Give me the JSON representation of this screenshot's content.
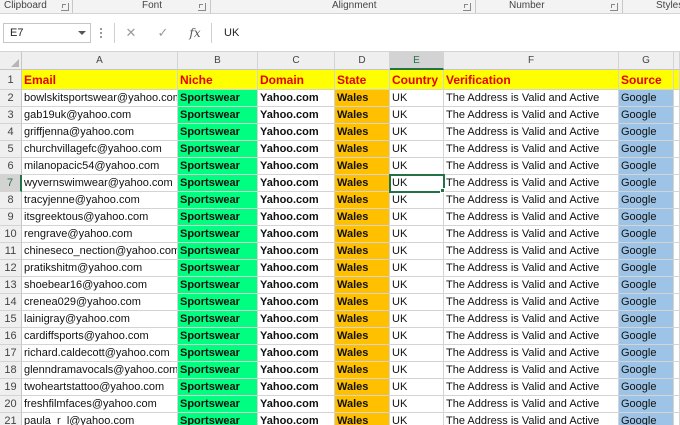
{
  "ribbon": {
    "groups": [
      "Clipboard",
      "Font",
      "Alignment",
      "Number",
      "Styles"
    ]
  },
  "formula_bar": {
    "name_box": "E7",
    "cancel_symbol": "✕",
    "enter_symbol": "✓",
    "fx_symbol": "fx",
    "content": "UK"
  },
  "columns": [
    "A",
    "B",
    "C",
    "D",
    "E",
    "F",
    "G"
  ],
  "selected_cell": {
    "column": "E",
    "row": 7
  },
  "sheet": {
    "header_row": {
      "row": 1,
      "cells": [
        "Email",
        "Niche",
        "Domain",
        "State",
        "Country",
        "Verification",
        "Source"
      ]
    },
    "rows": [
      {
        "row": 2,
        "email": "bowlskitsportswear@yahoo.com",
        "niche": "Sportswear",
        "domain": "Yahoo.com",
        "state": "Wales",
        "country": "UK",
        "verification": "The Address is Valid and  Active",
        "source": "Google"
      },
      {
        "row": 3,
        "email": "gab19uk@yahoo.com",
        "niche": "Sportswear",
        "domain": "Yahoo.com",
        "state": "Wales",
        "country": "UK",
        "verification": "The Address is Valid and  Active",
        "source": "Google"
      },
      {
        "row": 4,
        "email": "griffjenna@yahoo.com",
        "niche": "Sportswear",
        "domain": "Yahoo.com",
        "state": "Wales",
        "country": "UK",
        "verification": "The Address is Valid and  Active",
        "source": "Google"
      },
      {
        "row": 5,
        "email": "churchvillagefc@yahoo.com",
        "niche": "Sportswear",
        "domain": "Yahoo.com",
        "state": "Wales",
        "country": "UK",
        "verification": "The Address is Valid and  Active",
        "source": "Google"
      },
      {
        "row": 6,
        "email": "milanopacic54@yahoo.com",
        "niche": "Sportswear",
        "domain": "Yahoo.com",
        "state": "Wales",
        "country": "UK",
        "verification": "The Address is Valid and  Active",
        "source": "Google"
      },
      {
        "row": 7,
        "email": "wyvernswimwear@yahoo.com",
        "niche": "Sportswear",
        "domain": "Yahoo.com",
        "state": "Wales",
        "country": "UK",
        "verification": "The Address is Valid and  Active",
        "source": "Google"
      },
      {
        "row": 8,
        "email": "tracyjenne@yahoo.com",
        "niche": "Sportswear",
        "domain": "Yahoo.com",
        "state": "Wales",
        "country": "UK",
        "verification": "The Address is Valid and  Active",
        "source": "Google"
      },
      {
        "row": 9,
        "email": "itsgreektous@yahoo.com",
        "niche": "Sportswear",
        "domain": "Yahoo.com",
        "state": "Wales",
        "country": "UK",
        "verification": "The Address is Valid and  Active",
        "source": "Google"
      },
      {
        "row": 10,
        "email": "rengrave@yahoo.com",
        "niche": "Sportswear",
        "domain": "Yahoo.com",
        "state": "Wales",
        "country": "UK",
        "verification": "The Address is Valid and  Active",
        "source": "Google"
      },
      {
        "row": 11,
        "email": "chineseco_nection@yahoo.com",
        "niche": "Sportswear",
        "domain": "Yahoo.com",
        "state": "Wales",
        "country": "UK",
        "verification": "The Address is Valid and  Active",
        "source": "Google"
      },
      {
        "row": 12,
        "email": "pratikshitm@yahoo.com",
        "niche": "Sportswear",
        "domain": "Yahoo.com",
        "state": "Wales",
        "country": "UK",
        "verification": "The Address is Valid and  Active",
        "source": "Google"
      },
      {
        "row": 13,
        "email": "shoebear16@yahoo.com",
        "niche": "Sportswear",
        "domain": "Yahoo.com",
        "state": "Wales",
        "country": "UK",
        "verification": "The Address is Valid and  Active",
        "source": "Google"
      },
      {
        "row": 14,
        "email": "crenea029@yahoo.com",
        "niche": "Sportswear",
        "domain": "Yahoo.com",
        "state": "Wales",
        "country": "UK",
        "verification": "The Address is Valid and  Active",
        "source": "Google"
      },
      {
        "row": 15,
        "email": "lainigray@yahoo.com",
        "niche": "Sportswear",
        "domain": "Yahoo.com",
        "state": "Wales",
        "country": "UK",
        "verification": "The Address is Valid and  Active",
        "source": "Google"
      },
      {
        "row": 16,
        "email": "cardiffsports@yahoo.com",
        "niche": "Sportswear",
        "domain": "Yahoo.com",
        "state": "Wales",
        "country": "UK",
        "verification": "The Address is Valid and  Active",
        "source": "Google"
      },
      {
        "row": 17,
        "email": "richard.caldecott@yahoo.com",
        "niche": "Sportswear",
        "domain": "Yahoo.com",
        "state": "Wales",
        "country": "UK",
        "verification": "The Address is Valid and  Active",
        "source": "Google"
      },
      {
        "row": 18,
        "email": "glenndramavocals@yahoo.com",
        "niche": "Sportswear",
        "domain": "Yahoo.com",
        "state": "Wales",
        "country": "UK",
        "verification": "The Address is Valid and  Active",
        "source": "Google"
      },
      {
        "row": 19,
        "email": "twoheartstattoo@yahoo.com",
        "niche": "Sportswear",
        "domain": "Yahoo.com",
        "state": "Wales",
        "country": "UK",
        "verification": "The Address is Valid and  Active",
        "source": "Google"
      },
      {
        "row": 20,
        "email": "freshfilmfaces@yahoo.com",
        "niche": "Sportswear",
        "domain": "Yahoo.com",
        "state": "Wales",
        "country": "UK",
        "verification": "The Address is Valid and  Active",
        "source": "Google"
      },
      {
        "row": 21,
        "email": "paula_r_l@yahoo.com",
        "niche": "Sportswear",
        "domain": "Yahoo.com",
        "state": "Wales",
        "country": "UK",
        "verification": "The Address is Valid and  Active",
        "source": "Google"
      }
    ]
  },
  "colors": {
    "header_fill": "#ffff00",
    "header_text": "#e60000",
    "niche_fill": "#00ff80",
    "state_fill": "#ffc000",
    "source_fill": "#9dc3e6",
    "selection": "#217346"
  }
}
